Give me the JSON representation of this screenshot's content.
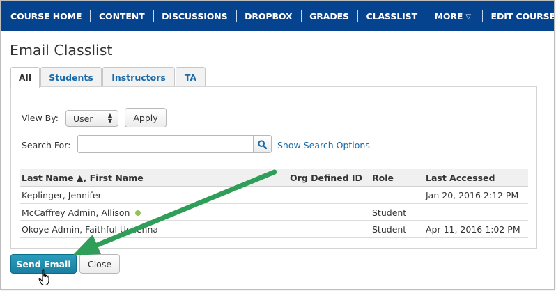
{
  "nav": {
    "items": [
      "COURSE HOME",
      "CONTENT",
      "DISCUSSIONS",
      "DROPBOX",
      "GRADES",
      "CLASSLIST",
      "MORE",
      "EDIT COURSE"
    ],
    "bg_color": "#06438f"
  },
  "page": {
    "title": "Email Classlist"
  },
  "tabs": [
    "All",
    "Students",
    "Instructors",
    "TA"
  ],
  "filters": {
    "view_by_label": "View By:",
    "view_by_value": "User",
    "apply_label": "Apply",
    "search_label": "Search For:",
    "search_value": "",
    "show_search_options": "Show Search Options"
  },
  "table": {
    "headers": [
      "Last Name ▲, First Name",
      "Org Defined ID",
      "Role",
      "Last Accessed"
    ],
    "rows": [
      {
        "name": "Keplinger, Jennifer",
        "org_id": "",
        "role": "-",
        "last_accessed": "Jan 20, 2016 2:12 PM",
        "online": false
      },
      {
        "name": "McCaffrey Admin, Allison",
        "org_id": "",
        "role": "Student",
        "last_accessed": "",
        "online": true
      },
      {
        "name": "Okoye Admin, Faithful Uchenna",
        "org_id": "",
        "role": "Student",
        "last_accessed": "Apr 11, 2016 1:02 PM",
        "online": false
      }
    ]
  },
  "actions": {
    "send_email_label": "Send Email",
    "close_label": "Close"
  },
  "colors": {
    "accent": "#1a6aa8",
    "send_button": "#1a8fb0",
    "arrow": "#2e9e58",
    "online": "#94c256"
  },
  "icons": {
    "search": "magnifier-icon",
    "more": "triangle-down-icon",
    "cursor": "hand-pointer-icon"
  }
}
